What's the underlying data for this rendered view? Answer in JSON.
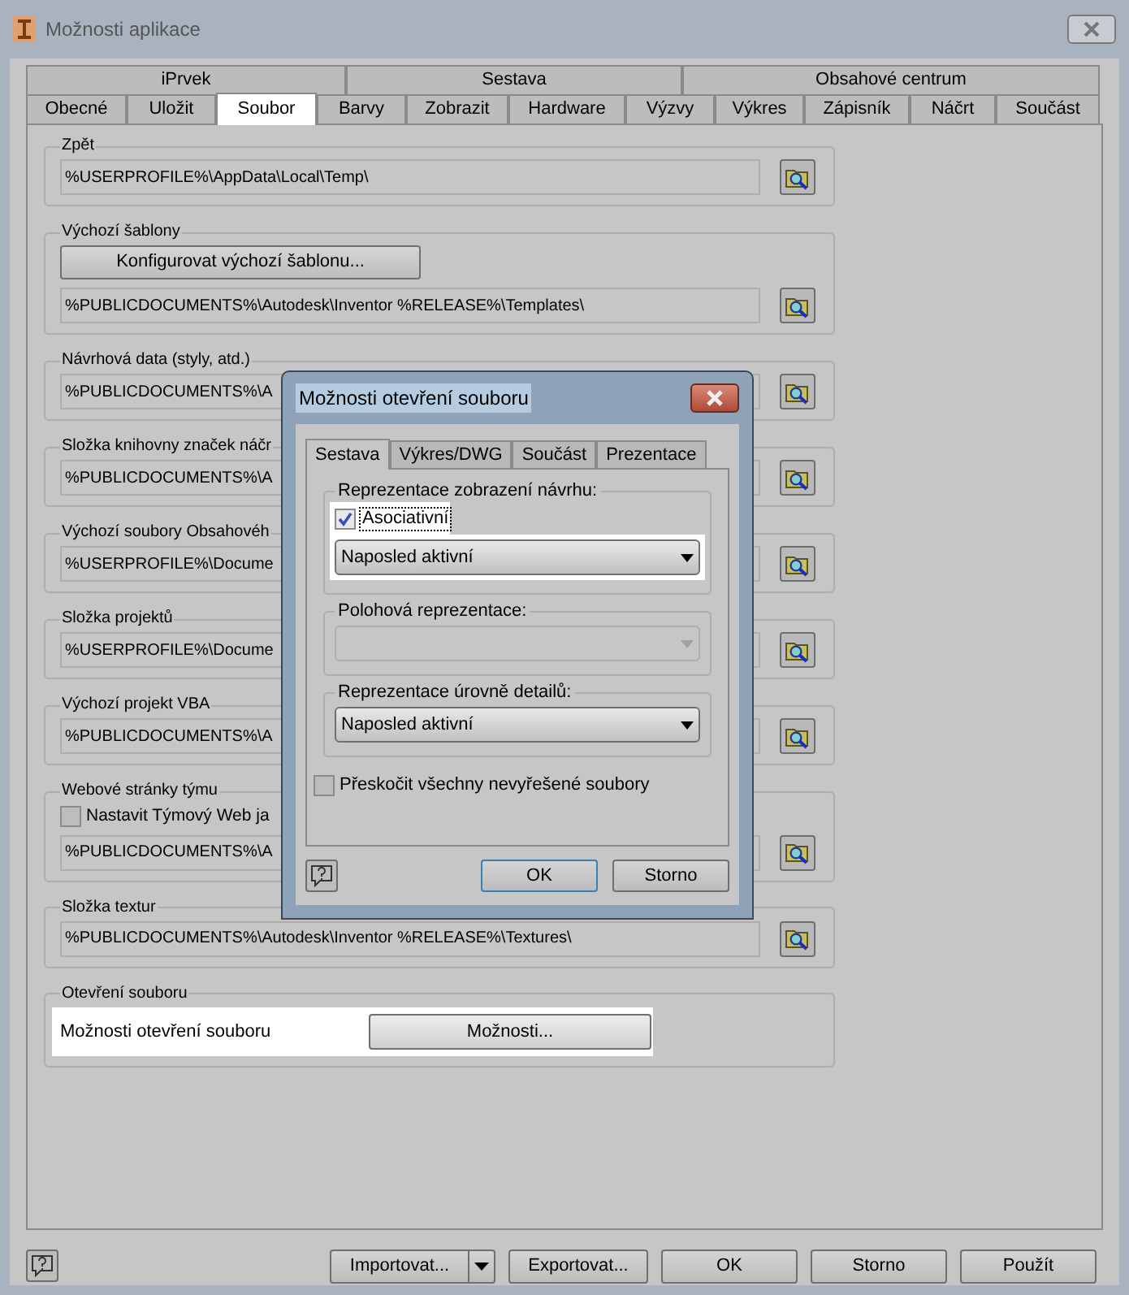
{
  "window": {
    "title": "Možnosti aplikace"
  },
  "tab_rows": [
    [
      {
        "label": "iPrvek",
        "selected": false
      },
      {
        "label": "Sestava",
        "selected": false
      },
      {
        "label": "Obsahové centrum",
        "selected": false
      }
    ],
    [
      {
        "label": "Obecné",
        "selected": false
      },
      {
        "label": "Uložit",
        "selected": false
      },
      {
        "label": "Soubor",
        "selected": true
      },
      {
        "label": "Barvy",
        "selected": false
      },
      {
        "label": "Zobrazit",
        "selected": false
      },
      {
        "label": "Hardware",
        "selected": false
      },
      {
        "label": "Výzvy",
        "selected": false
      },
      {
        "label": "Výkres",
        "selected": false
      },
      {
        "label": "Zápisník",
        "selected": false
      },
      {
        "label": "Náčrt",
        "selected": false
      },
      {
        "label": "Součást",
        "selected": false
      }
    ]
  ],
  "sections": [
    {
      "kind": "path",
      "legend": "Zpět",
      "value": "%USERPROFILE%\\AppData\\Local\\Temp\\"
    },
    {
      "kind": "template",
      "legend": "Výchozí šablony",
      "button": "Konfigurovat výchozí šablonu...",
      "value": "%PUBLICDOCUMENTS%\\Autodesk\\Inventor %RELEASE%\\Templates\\"
    },
    {
      "kind": "path",
      "legend": "Návrhová data (styly, atd.)",
      "value": "%PUBLICDOCUMENTS%\\A"
    },
    {
      "kind": "path",
      "legend": "Složka knihovny značek náčr",
      "value": "%PUBLICDOCUMENTS%\\A"
    },
    {
      "kind": "path",
      "legend": "Výchozí soubory Obsahovéh",
      "value": "%USERPROFILE%\\Docume"
    },
    {
      "kind": "path",
      "legend": "Složka projektů",
      "value": "%USERPROFILE%\\Docume"
    },
    {
      "kind": "path",
      "legend": "Výchozí projekt VBA",
      "value": "%PUBLICDOCUMENTS%\\A"
    },
    {
      "kind": "team",
      "legend": "Webové stránky týmu",
      "checkbox": {
        "label": "Nastavit Týmový Web ja",
        "checked": false
      },
      "value": "%PUBLICDOCUMENTS%\\A"
    },
    {
      "kind": "path",
      "legend": "Složka textur",
      "value": "%PUBLICDOCUMENTS%\\Autodesk\\Inventor %RELEASE%\\Textures\\"
    },
    {
      "kind": "open",
      "legend": "Otevření souboru",
      "label": "Možnosti otevření souboru",
      "button": "Možnosti..."
    }
  ],
  "footer": {
    "buttons": [
      {
        "label": "Importovat...",
        "kind": "split"
      },
      {
        "label": "Exportovat...",
        "kind": "plain"
      },
      {
        "label": "OK",
        "kind": "plain"
      },
      {
        "label": "Storno",
        "kind": "plain"
      },
      {
        "label": "Použít",
        "kind": "plain"
      }
    ]
  },
  "dialog": {
    "title": "Možnosti otevření souboru",
    "tabs": [
      {
        "label": "Sestava",
        "selected": true
      },
      {
        "label": "Výkres/DWG",
        "selected": false
      },
      {
        "label": "Součást",
        "selected": false
      },
      {
        "label": "Prezentace",
        "selected": false
      }
    ],
    "groups": [
      {
        "legend": "Reprezentace zobrazení návrhu:",
        "checkbox": {
          "label": "Asociativní",
          "checked": true
        },
        "dropdown": {
          "value": "Naposled aktivní",
          "disabled": false
        }
      },
      {
        "legend": "Polohová reprezentace:",
        "dropdown": {
          "disabled": true
        }
      },
      {
        "legend": "Reprezentace úrovně detailů:",
        "dropdown": {
          "value": "Naposled aktivní",
          "disabled": false
        }
      }
    ],
    "skip": {
      "label": "Přeskočit všechny nevyřešené soubory",
      "checked": false
    },
    "buttons": [
      {
        "label": "OK",
        "default": true
      },
      {
        "label": "Storno",
        "default": false
      }
    ]
  }
}
